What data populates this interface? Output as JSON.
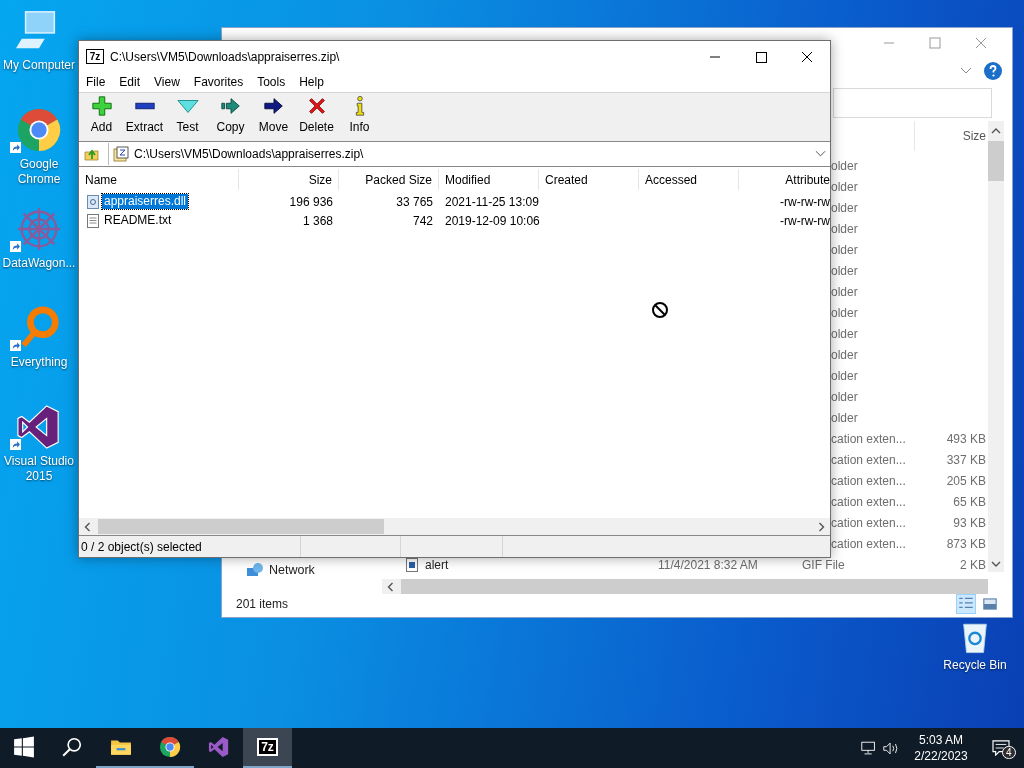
{
  "desktop_icons": [
    {
      "label": "My Computer",
      "kind": "computer",
      "shortcut": false
    },
    {
      "label": "Google Chrome",
      "kind": "chrome",
      "shortcut": true
    },
    {
      "label": "DataWagon...",
      "kind": "datawagon",
      "shortcut": true
    },
    {
      "label": "Everything",
      "kind": "everything",
      "shortcut": true
    },
    {
      "label": "Visual Studio 2015",
      "kind": "vs",
      "shortcut": true
    }
  ],
  "recycle_bin": {
    "label": "Recycle Bin"
  },
  "explorer": {
    "size_header": "Size",
    "rows": [
      {
        "type": "older"
      },
      {
        "type": "older"
      },
      {
        "type": "older"
      },
      {
        "type": "older"
      },
      {
        "type": "older"
      },
      {
        "type": "older"
      },
      {
        "type": "older"
      },
      {
        "type": "older"
      },
      {
        "type": "older"
      },
      {
        "type": "older"
      },
      {
        "type": "older"
      },
      {
        "type": "older"
      },
      {
        "type": "older"
      },
      {
        "type": "cation exten...",
        "size": "493 KB"
      },
      {
        "type": "cation exten...",
        "size": "337 KB"
      },
      {
        "type": "cation exten...",
        "size": "205 KB"
      },
      {
        "type": "cation exten...",
        "size": "65 KB"
      },
      {
        "type": "cation exten...",
        "size": "93 KB"
      },
      {
        "type": "cation exten...",
        "size": "873 KB"
      },
      {
        "name": "alert",
        "date": "11/4/2021 8:32 AM",
        "type": "GIF File",
        "size": "2 KB"
      }
    ],
    "nav_item": "Network",
    "status": "201 items"
  },
  "archiver": {
    "icon_text": "7z",
    "title": "C:\\Users\\VM5\\Downloads\\appraiserres.zip\\",
    "menu": [
      "File",
      "Edit",
      "View",
      "Favorites",
      "Tools",
      "Help"
    ],
    "toolbar": [
      {
        "label": "Add",
        "kind": "add"
      },
      {
        "label": "Extract",
        "kind": "extract"
      },
      {
        "label": "Test",
        "kind": "test"
      },
      {
        "label": "Copy",
        "kind": "copy"
      },
      {
        "label": "Move",
        "kind": "move"
      },
      {
        "label": "Delete",
        "kind": "delete"
      },
      {
        "label": "Info",
        "kind": "info"
      }
    ],
    "address": "C:\\Users\\VM5\\Downloads\\appraiserres.zip\\",
    "columns": [
      {
        "label": "Name"
      },
      {
        "label": "Size"
      },
      {
        "label": "Packed Size"
      },
      {
        "label": "Modified"
      },
      {
        "label": "Created"
      },
      {
        "label": "Accessed"
      },
      {
        "label": "Attribute"
      }
    ],
    "files": [
      {
        "name": "appraiserres.dll",
        "kind": "dll",
        "size": "196 936",
        "packed": "33 765",
        "modified": "2021-11-25 13:09",
        "attributes": "-rw-rw-rw",
        "selected": true
      },
      {
        "name": "README.txt",
        "kind": "txt",
        "size": "1 368",
        "packed": "742",
        "modified": "2019-12-09 10:06",
        "attributes": "-rw-rw-rw",
        "selected": false
      }
    ],
    "status": "0 / 2 object(s) selected"
  },
  "taskbar": {
    "apps": [
      {
        "kind": "start",
        "running": false,
        "selected": false
      },
      {
        "kind": "search",
        "running": false,
        "selected": false
      },
      {
        "kind": "explorer",
        "running": true,
        "selected": false
      },
      {
        "kind": "chrome",
        "running": true,
        "selected": false
      },
      {
        "kind": "vs",
        "running": false,
        "selected": false
      },
      {
        "kind": "sevenzip",
        "glyph": "7z",
        "running": true,
        "selected": true
      }
    ],
    "time": "5:03 AM",
    "date": "2/22/2023",
    "notifications": "4"
  }
}
